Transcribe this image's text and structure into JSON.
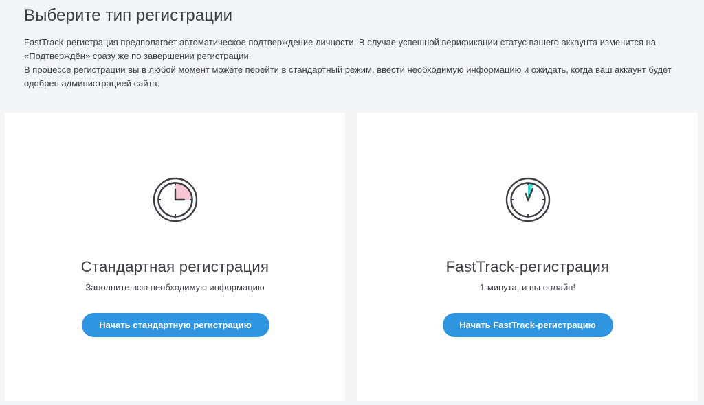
{
  "header": {
    "title": "Выберите тип регистрации"
  },
  "intro": {
    "line1": "FastTrack-регистрация предполагает автоматическое подтверждение личности. В случае успешной верификации статус вашего аккаунта изменится на «Подтверждён» сразу же по завершении регистрации.",
    "line2": "В процессе регистрации вы в любой момент можете перейти в стандартный режим, ввести необходимую информацию и ожидать, когда ваш аккаунт будет одобрен администрацией сайта."
  },
  "cards": [
    {
      "icon": "clock-icon",
      "accent": "#f7c6d4",
      "title": "Стандартная регистрация",
      "subtitle": "Заполните всю необходимую информацию",
      "button_label": "Начать стандартную регистрацию"
    },
    {
      "icon": "stopwatch-icon",
      "accent": "#3ddbd0",
      "title": "FastTrack-регистрация",
      "subtitle": "1 минута, и вы онлайн!",
      "button_label": "Начать FastTrack-регистрацию"
    }
  ],
  "colors": {
    "background": "#f4f5f7",
    "card": "#ffffff",
    "button": "#2f95e0",
    "text": "#3a3d42"
  }
}
